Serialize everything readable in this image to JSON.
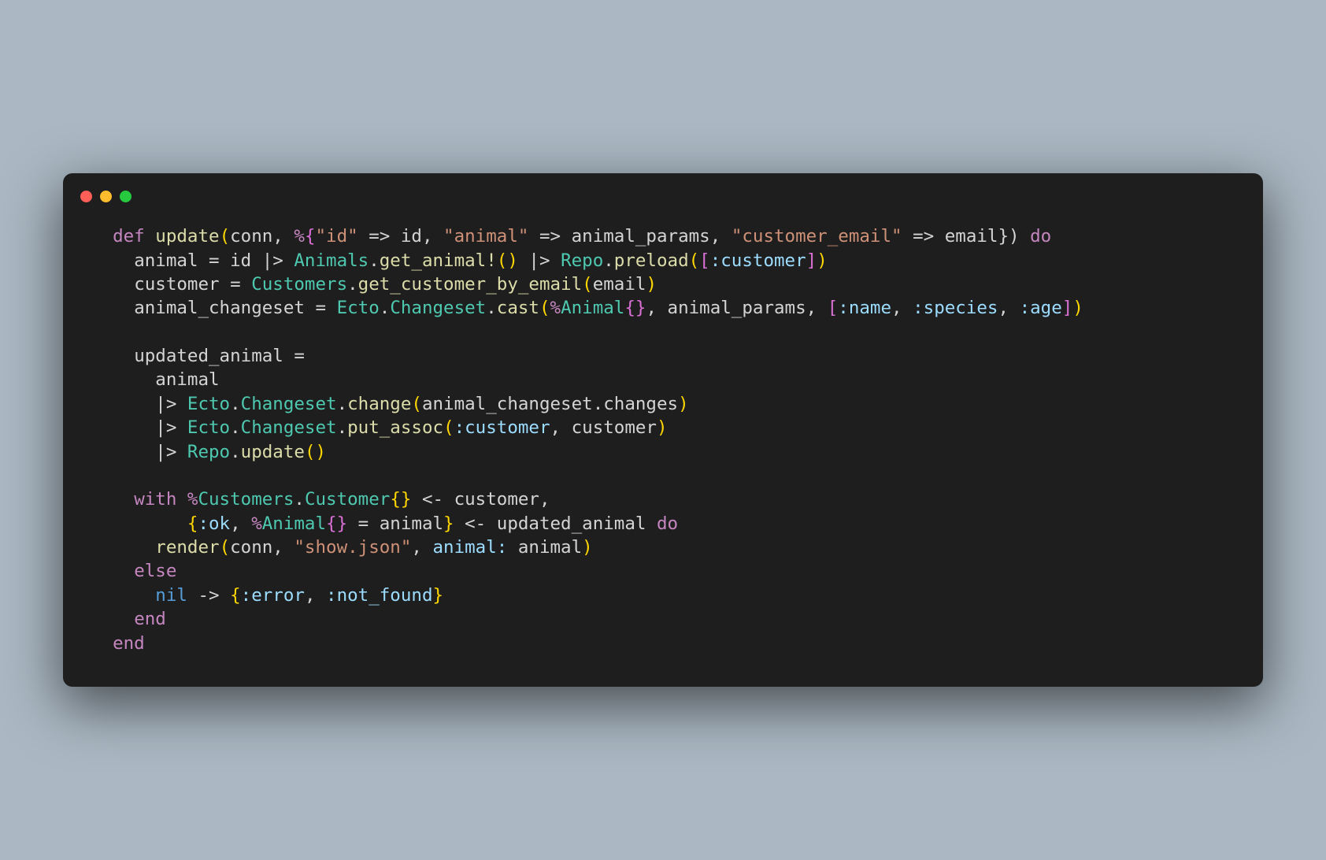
{
  "lines": {
    "l1": {
      "indent": "  ",
      "def": "def",
      "fn": "update",
      "open": "(",
      "conn": "conn",
      "c1": ", ",
      "pct": "%",
      "ob": "{",
      "s1": "\"id\"",
      "arr": " => ",
      "id": "id",
      "c2": ", ",
      "s2": "\"animal\"",
      "ap": "animal_params",
      "c3": ", ",
      "s3": "\"customer_email\"",
      "emailwrap": "email}) ",
      "do": "do"
    },
    "l2": {
      "indent": "    ",
      "animal": "animal",
      "eq": " = ",
      "id": "id ",
      "pipe": "|> ",
      "mod1": "Animals",
      "dot": ".",
      "fn1": "get_animal!",
      "p1": "() ",
      "mod2": "Repo",
      "fn2": "preload",
      "open": "(",
      "br": "[",
      "atom": ":customer",
      "cb": "]",
      "close": ")"
    },
    "l3": {
      "indent": "    ",
      "cust": "customer",
      "eq": " = ",
      "mod": "Customers",
      "dot": ".",
      "fn": "get_customer_by_email",
      "open": "(",
      "arg": "email",
      "close": ")"
    },
    "l4": {
      "indent": "    ",
      "var": "animal_changeset",
      "eq": " = ",
      "mod1": "Ecto",
      "dot": ".",
      "mod2": "Changeset",
      "fn": "cast",
      "open": "(",
      "pct": "%",
      "animal": "Animal",
      "ob": "{}",
      "c1": ", ",
      "ap": "animal_params",
      "c2": ", ",
      "br": "[",
      "a1": ":name",
      "c3": ", ",
      "a2": ":species",
      "c4": ", ",
      "a3": ":age",
      "cb": "]",
      "close": ")"
    },
    "l6": {
      "indent": "    ",
      "var": "updated_animal",
      "eq": " ="
    },
    "l7": {
      "indent": "      ",
      "animal": "animal"
    },
    "l8": {
      "indent": "      ",
      "pipe": "|> ",
      "mod1": "Ecto",
      "dot": ".",
      "mod2": "Changeset",
      "fn": "change",
      "open": "(",
      "arg": "animal_changeset.changes",
      "close": ")"
    },
    "l9": {
      "indent": "      ",
      "pipe": "|> ",
      "mod1": "Ecto",
      "dot": ".",
      "mod2": "Changeset",
      "fn": "put_assoc",
      "open": "(",
      "atom": ":customer",
      "c": ", ",
      "cust": "customer",
      "close": ")"
    },
    "l10": {
      "indent": "      ",
      "pipe": "|> ",
      "mod": "Repo",
      "dot": ".",
      "fn": "update",
      "p": "()"
    },
    "l12": {
      "indent": "    ",
      "with": "with",
      "sp": " ",
      "pct": "%",
      "mod1": "Customers",
      "dot": ".",
      "mod2": "Customer",
      "ob": "{}",
      "arr": " <- ",
      "cust": "customer",
      "c": ","
    },
    "l13": {
      "indent": "         ",
      "ob": "{",
      "atom": ":ok",
      "c1": ", ",
      "pct": "%",
      "mod": "Animal",
      "br": "{}",
      "eq": " = ",
      "animal": "animal",
      "cb": "}",
      "arr": " <- ",
      "ua": "updated_animal ",
      "do": "do"
    },
    "l14": {
      "indent": "      ",
      "fn": "render",
      "open": "(",
      "conn": "conn",
      "c1": ", ",
      "s": "\"show.json\"",
      "c2": ", ",
      "atom": "animal:",
      "sp": " ",
      "animal": "animal",
      "close": ")"
    },
    "l15": {
      "indent": "    ",
      "else": "else"
    },
    "l16": {
      "indent": "      ",
      "nil": "nil",
      "arr": " -> ",
      "ob": "{",
      "a1": ":error",
      "c": ", ",
      "a2": ":not_found",
      "cb": "}"
    },
    "l17": {
      "indent": "    ",
      "end": "end"
    },
    "l18": {
      "indent": "  ",
      "end": "end"
    }
  }
}
